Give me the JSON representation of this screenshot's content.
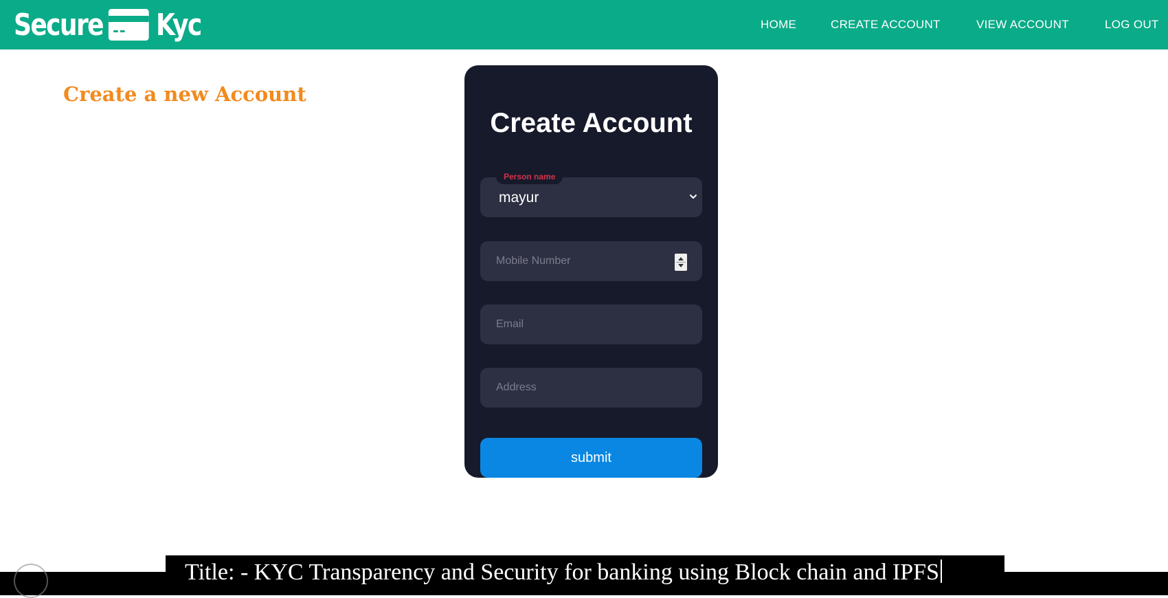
{
  "header": {
    "brand_left": "Secure",
    "brand_right": "Kyc",
    "brand_icon": "credit-card-icon",
    "nav": {
      "home": "HOME",
      "create_account": "CREATE ACCOUNT",
      "view_account": "VIEW ACCOUNT",
      "log_out": "LOG OUT"
    }
  },
  "page": {
    "heading": "Create a new Account"
  },
  "form": {
    "title": "Create Account",
    "person_name": {
      "label": "Person name",
      "selected_value": "mayur"
    },
    "mobile": {
      "value": "",
      "placeholder": "Mobile Number"
    },
    "email": {
      "value": "",
      "placeholder": "Email"
    },
    "address": {
      "value": "",
      "placeholder": "Address"
    },
    "submit_label": "submit"
  },
  "overlay": {
    "caption": "Title: - KYC Transparency and Security for banking using Block chain and IPFS"
  },
  "colors": {
    "header_bg": "#0aab88",
    "heading": "#f28a1e",
    "card_bg": "#171a2b",
    "field_bg": "#2d2f42",
    "label_red": "#d4324a",
    "submit_bg": "#0987e2"
  }
}
